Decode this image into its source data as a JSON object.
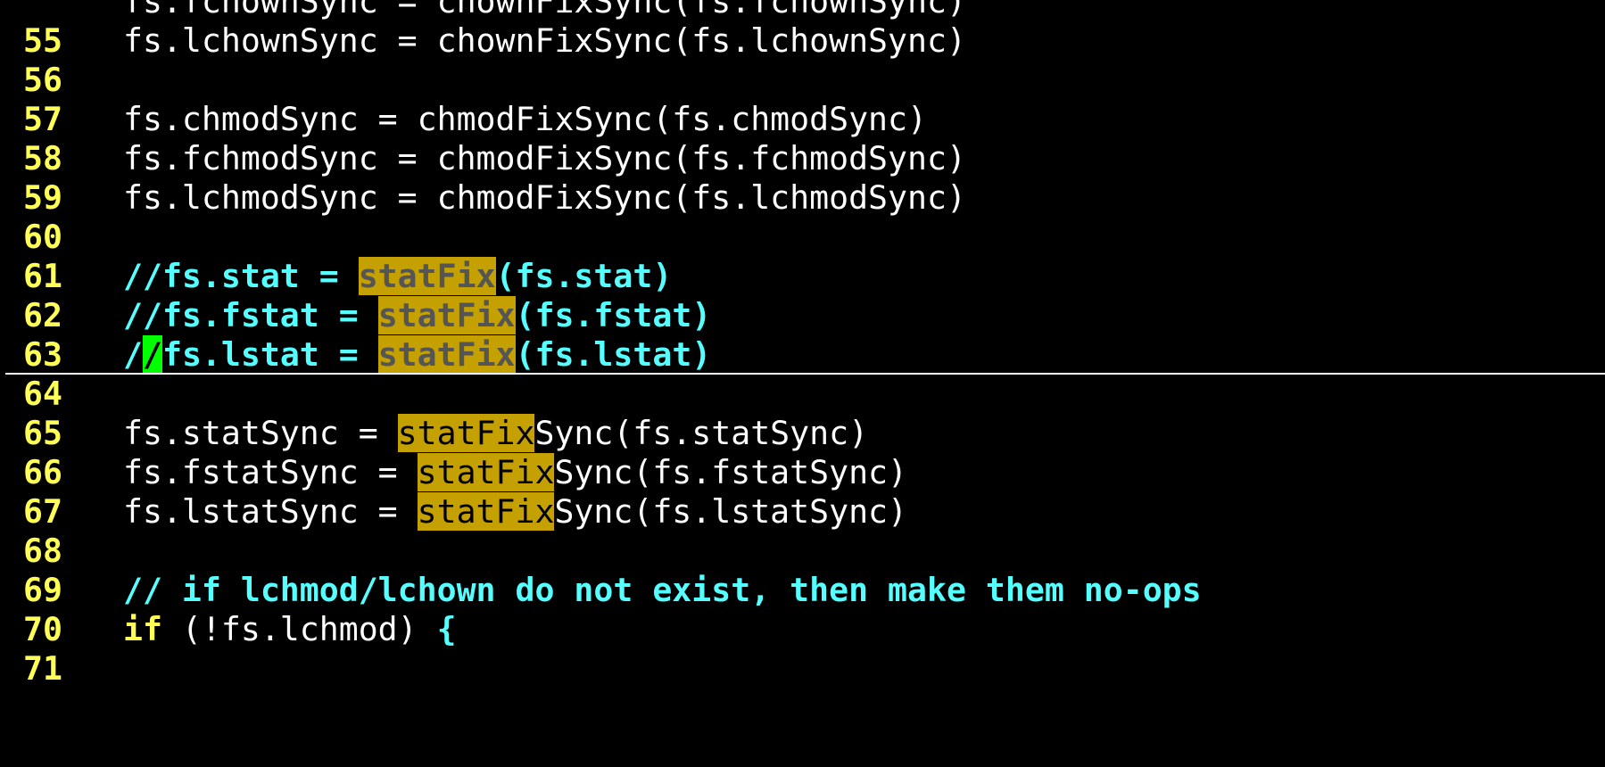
{
  "lines": [
    {
      "num": "55",
      "segs": [
        [
          "plain",
          "fs.fchownSync = chownFixSync(fs.fchownSync)"
        ]
      ]
    },
    {
      "num": "56",
      "segs": [
        [
          "plain",
          "fs.lchownSync = chownFixSync(fs.lchownSync)"
        ]
      ]
    },
    {
      "num": "57",
      "segs": []
    },
    {
      "num": "58",
      "segs": [
        [
          "plain",
          "fs.chmodSync = chmodFixSync(fs.chmodSync)"
        ]
      ]
    },
    {
      "num": "59",
      "segs": [
        [
          "plain",
          "fs.fchmodSync = chmodFixSync(fs.fchmodSync)"
        ]
      ]
    },
    {
      "num": "60",
      "segs": [
        [
          "plain",
          "fs.lchmodSync = chmodFixSync(fs.lchmodSync)"
        ]
      ]
    },
    {
      "num": "61",
      "segs": []
    },
    {
      "num": "62",
      "segs": [
        [
          "comment",
          "//fs.stat = "
        ],
        [
          "search-comment",
          "statFix"
        ],
        [
          "comment",
          "(fs.stat)"
        ]
      ]
    },
    {
      "num": "63",
      "segs": [
        [
          "comment",
          "//fs.fstat = "
        ],
        [
          "search-comment",
          "statFix"
        ],
        [
          "comment",
          "(fs.fstat)"
        ]
      ]
    },
    {
      "num": "64",
      "cursorline": true,
      "segs": [
        [
          "comment",
          "/"
        ],
        [
          "cursor",
          "/"
        ],
        [
          "comment",
          "fs.lstat = "
        ],
        [
          "search-comment",
          "statFix"
        ],
        [
          "comment",
          "(fs.lstat)"
        ]
      ]
    },
    {
      "num": "65",
      "segs": []
    },
    {
      "num": "66",
      "segs": [
        [
          "plain",
          "fs.statSync = "
        ],
        [
          "search",
          "statFix"
        ],
        [
          "plain",
          "Sync(fs.statSync)"
        ]
      ]
    },
    {
      "num": "67",
      "segs": [
        [
          "plain",
          "fs.fstatSync = "
        ],
        [
          "search",
          "statFix"
        ],
        [
          "plain",
          "Sync(fs.fstatSync)"
        ]
      ]
    },
    {
      "num": "68",
      "segs": [
        [
          "plain",
          "fs.lstatSync = "
        ],
        [
          "search",
          "statFix"
        ],
        [
          "plain",
          "Sync(fs.lstatSync)"
        ]
      ]
    },
    {
      "num": "69",
      "segs": []
    },
    {
      "num": "70",
      "segs": [
        [
          "comment",
          "// if lchmod/lchown do not exist, then make them no-ops"
        ]
      ]
    },
    {
      "num": "71",
      "segs": [
        [
          "keyword",
          "if"
        ],
        [
          "plain",
          " (!fs.lchmod) "
        ],
        [
          "brace",
          "{"
        ]
      ]
    }
  ]
}
